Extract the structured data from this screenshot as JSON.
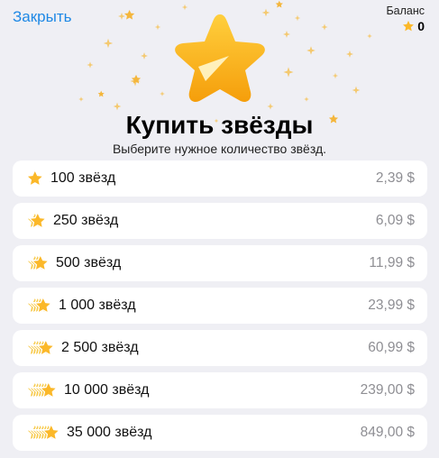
{
  "header": {
    "close_label": "Закрыть",
    "balance_label": "Баланс",
    "balance_value": "0"
  },
  "title": "Купить звёзды",
  "subtitle": "Выберите нужное количество звёзд.",
  "colors": {
    "accent": "#1e88e5",
    "star_gold": "#fbb829",
    "price_gray": "#8e8e93",
    "background": "#efeff4"
  },
  "icons": [
    "star-icon",
    "star-stack-icon"
  ],
  "options": [
    {
      "label": "100 звёзд",
      "price": "2,39 $",
      "stars": 1
    },
    {
      "label": "250 звёзд",
      "price": "6,09 $",
      "stars": 2
    },
    {
      "label": "500 звёзд",
      "price": "11,99 $",
      "stars": 3
    },
    {
      "label": "1 000 звёзд",
      "price": "23,99 $",
      "stars": 4
    },
    {
      "label": "2 500 звёзд",
      "price": "60,99 $",
      "stars": 5
    },
    {
      "label": "10 000 звёзд",
      "price": "239,00 $",
      "stars": 6
    },
    {
      "label": "35 000 звёзд",
      "price": "849,00 $",
      "stars": 7
    }
  ]
}
